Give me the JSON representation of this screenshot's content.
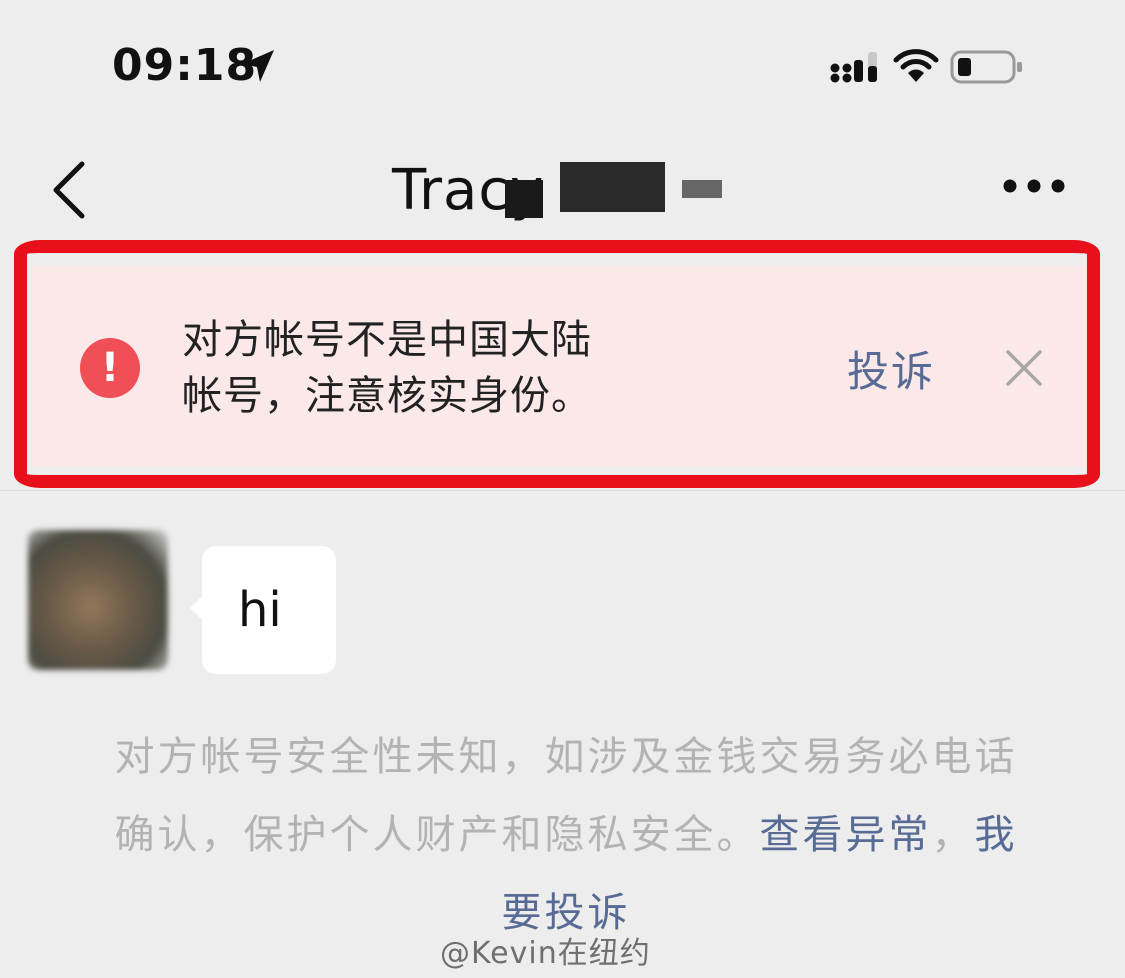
{
  "status_bar": {
    "time": "09:18",
    "icons": [
      "location-arrow-icon",
      "cellular-signal-icon",
      "wifi-icon",
      "battery-icon"
    ]
  },
  "nav": {
    "title": "Tracy",
    "back_icon": "chevron-left-icon",
    "more_icon": "more-dots-icon"
  },
  "warning": {
    "line1": "对方帐号不是中国大陆",
    "line2": "帐号，注意核实身份。",
    "complain_label": "投诉",
    "colors": {
      "background": "#fbe9e9",
      "alert": "#f05055",
      "link": "#576b95",
      "highlight": "#e8101a"
    }
  },
  "messages": [
    {
      "sender": "other",
      "text": "hi"
    }
  ],
  "system_notice": {
    "text": "对方帐号安全性未知，如涉及金钱交易务必电话确认，保护个人财产和隐私安全。",
    "link1": "查看异常",
    "separator": "，",
    "link2": "我要投诉"
  },
  "watermark": "@Kevin在纽约"
}
